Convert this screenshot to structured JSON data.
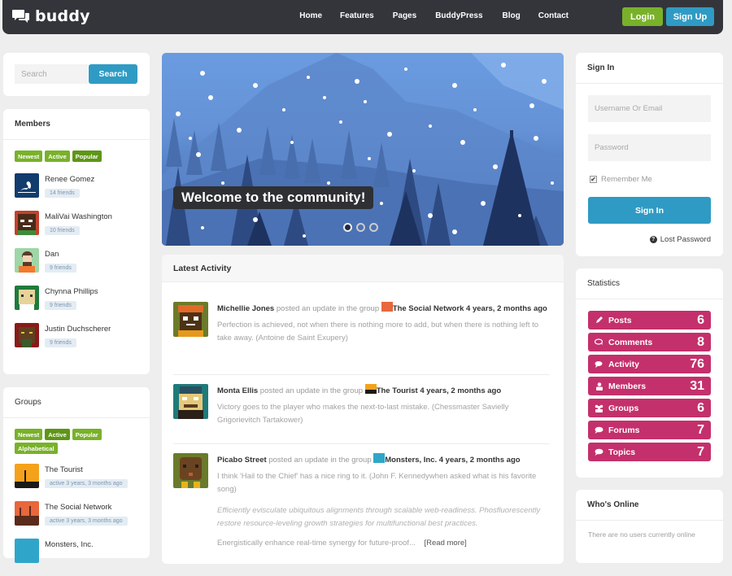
{
  "header": {
    "logo_text": "buddy",
    "nav": [
      "Home",
      "Features",
      "Pages",
      "BuddyPress",
      "Blog",
      "Contact"
    ],
    "login_label": "Login",
    "signup_label": "Sign Up"
  },
  "search": {
    "placeholder": "Search",
    "button_label": "Search"
  },
  "members": {
    "title": "Members",
    "filters": [
      "Newest",
      "Active",
      "Popular"
    ],
    "active_filter": "Popular",
    "items": [
      {
        "name": "Renee Gomez",
        "badge": "14 friends"
      },
      {
        "name": "MaliVai Washington",
        "badge": "10 friends"
      },
      {
        "name": "Dan",
        "badge": "9 friends"
      },
      {
        "name": "Chynna Phillips",
        "badge": "9 friends"
      },
      {
        "name": "Justin Duchscherer",
        "badge": "9 friends"
      }
    ]
  },
  "groups": {
    "title": "Groups",
    "filters": [
      "Newest",
      "Active",
      "Popular",
      "Alphabetical"
    ],
    "active_filter": "Active",
    "items": [
      {
        "name": "The Tourist",
        "badge": "active 3 years, 3 months ago"
      },
      {
        "name": "The Social Network",
        "badge": "active 3 years, 3 months ago"
      },
      {
        "name": "Monsters, Inc.",
        "badge": ""
      }
    ]
  },
  "slider": {
    "caption": "Welcome to the community!",
    "slide_count": 3,
    "current_slide": 1
  },
  "activity": {
    "title": "Latest Activity",
    "items": [
      {
        "user": "Michellie Jones",
        "action": " posted an update in the group ",
        "group": "The Social Network",
        "time": " 4 years, 2 months ago",
        "text": "Perfection is achieved, not when there is nothing more to add, but when there is nothing left to take away. (Antoine de Saint Exupery)"
      },
      {
        "user": "Monta Ellis",
        "action": " posted an update in the group ",
        "group": "The Tourist",
        "time": " 4 years, 2 months ago",
        "text": "Victory goes to the player who makes the next-to-last mistake. (Chessmaster Savielly Grigorievitch Tartakower)"
      },
      {
        "user": "Picabo Street",
        "action": " posted an update in the group ",
        "group": "Monsters, Inc.",
        "time": " 4 years, 2 months ago",
        "text": "I think 'Hail to the Chief' has a nice ring to it. (John F. Kennedywhen asked what is his favorite song)",
        "italic": "Efficiently evisculate ubiquitous alignments through scalable web-readiness. Phosfluorescently restore resource-leveling growth strategies for multifunctional best practices.",
        "more": "Energistically enhance real-time synergy for future-proof...",
        "read_more": "[Read more]"
      }
    ]
  },
  "signin": {
    "title": "Sign In",
    "username_placeholder": "Username Or Email",
    "password_placeholder": "Password",
    "remember_label": "Remember Me",
    "remember_checked": true,
    "button_label": "Sign In",
    "lost_password": "Lost Password"
  },
  "statistics": {
    "title": "Statistics",
    "color": "#c4306b",
    "items": [
      {
        "icon": "pencil-icon",
        "label": "Posts",
        "value": "6"
      },
      {
        "icon": "comments-icon",
        "label": "Comments",
        "value": "8"
      },
      {
        "icon": "chat-icon",
        "label": "Activity",
        "value": "76"
      },
      {
        "icon": "user-icon",
        "label": "Members",
        "value": "31"
      },
      {
        "icon": "group-icon",
        "label": "Groups",
        "value": "6"
      },
      {
        "icon": "speech-bubble-icon",
        "label": "Forums",
        "value": "7"
      },
      {
        "icon": "speech-bubble-icon",
        "label": "Topics",
        "value": "7"
      }
    ]
  },
  "whos_online": {
    "title": "Who's Online",
    "text": "There are no users currently online"
  }
}
